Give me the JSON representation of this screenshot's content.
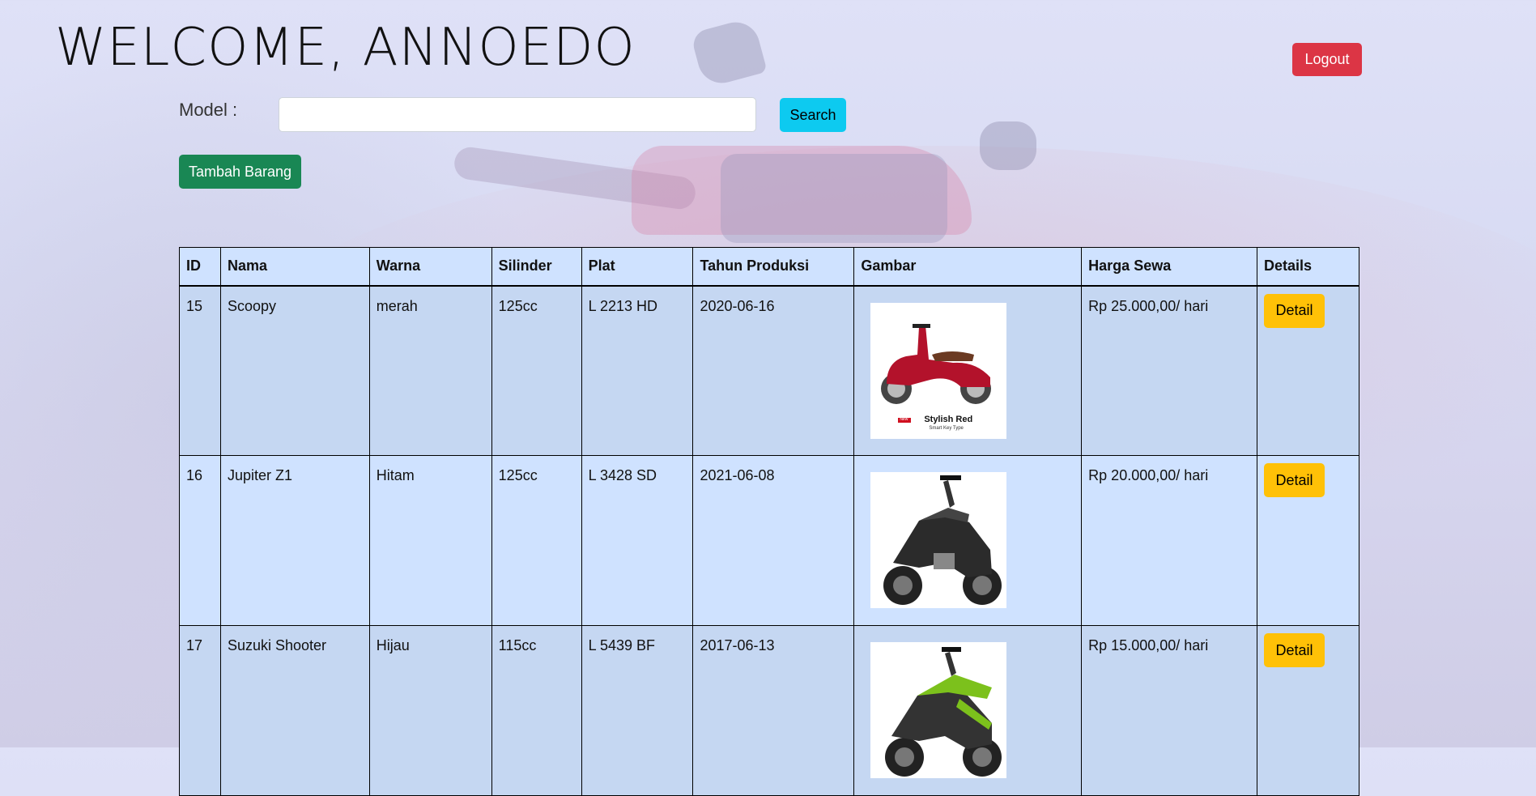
{
  "header": {
    "welcome_text": "WELCOME, ANNOEDO",
    "logout_label": "Logout"
  },
  "search": {
    "label": "Model :",
    "value": "",
    "placeholder": "",
    "button_label": "Search"
  },
  "actions": {
    "add_label": "Tambah Barang"
  },
  "table": {
    "columns": [
      "ID",
      "Nama",
      "Warna",
      "Silinder",
      "Plat",
      "Tahun Produksi",
      "Gambar",
      "Harga Sewa",
      "Details"
    ],
    "rows": [
      {
        "id": "15",
        "nama": "Scoopy",
        "warna": "merah",
        "silinder": "125cc",
        "plat": "L 2213 HD",
        "tahun": "2020-06-16",
        "image_badge": "New",
        "image_caption": "Stylish Red",
        "image_subcaption": "Smart Key Type",
        "harga": "Rp 25.000,00/ hari",
        "detail_label": "Detail"
      },
      {
        "id": "16",
        "nama": "Jupiter Z1",
        "warna": "Hitam",
        "silinder": "125cc",
        "plat": "L 3428 SD",
        "tahun": "2021-06-08",
        "harga": "Rp 20.000,00/ hari",
        "detail_label": "Detail"
      },
      {
        "id": "17",
        "nama": "Suzuki Shooter",
        "warna": "Hijau",
        "silinder": "115cc",
        "plat": "L 5439 BF",
        "tahun": "2017-06-13",
        "harga": "Rp 15.000,00/ hari",
        "detail_label": "Detail"
      }
    ]
  },
  "colors": {
    "logout": "#dc3545",
    "search": "#0dcaf0",
    "add": "#198754",
    "detail": "#ffc107",
    "table_header": "#cfe2ff"
  },
  "icons": [
    "motorcycle-scoopy-image",
    "motorcycle-jupiter-image",
    "motorcycle-shooter-image"
  ]
}
